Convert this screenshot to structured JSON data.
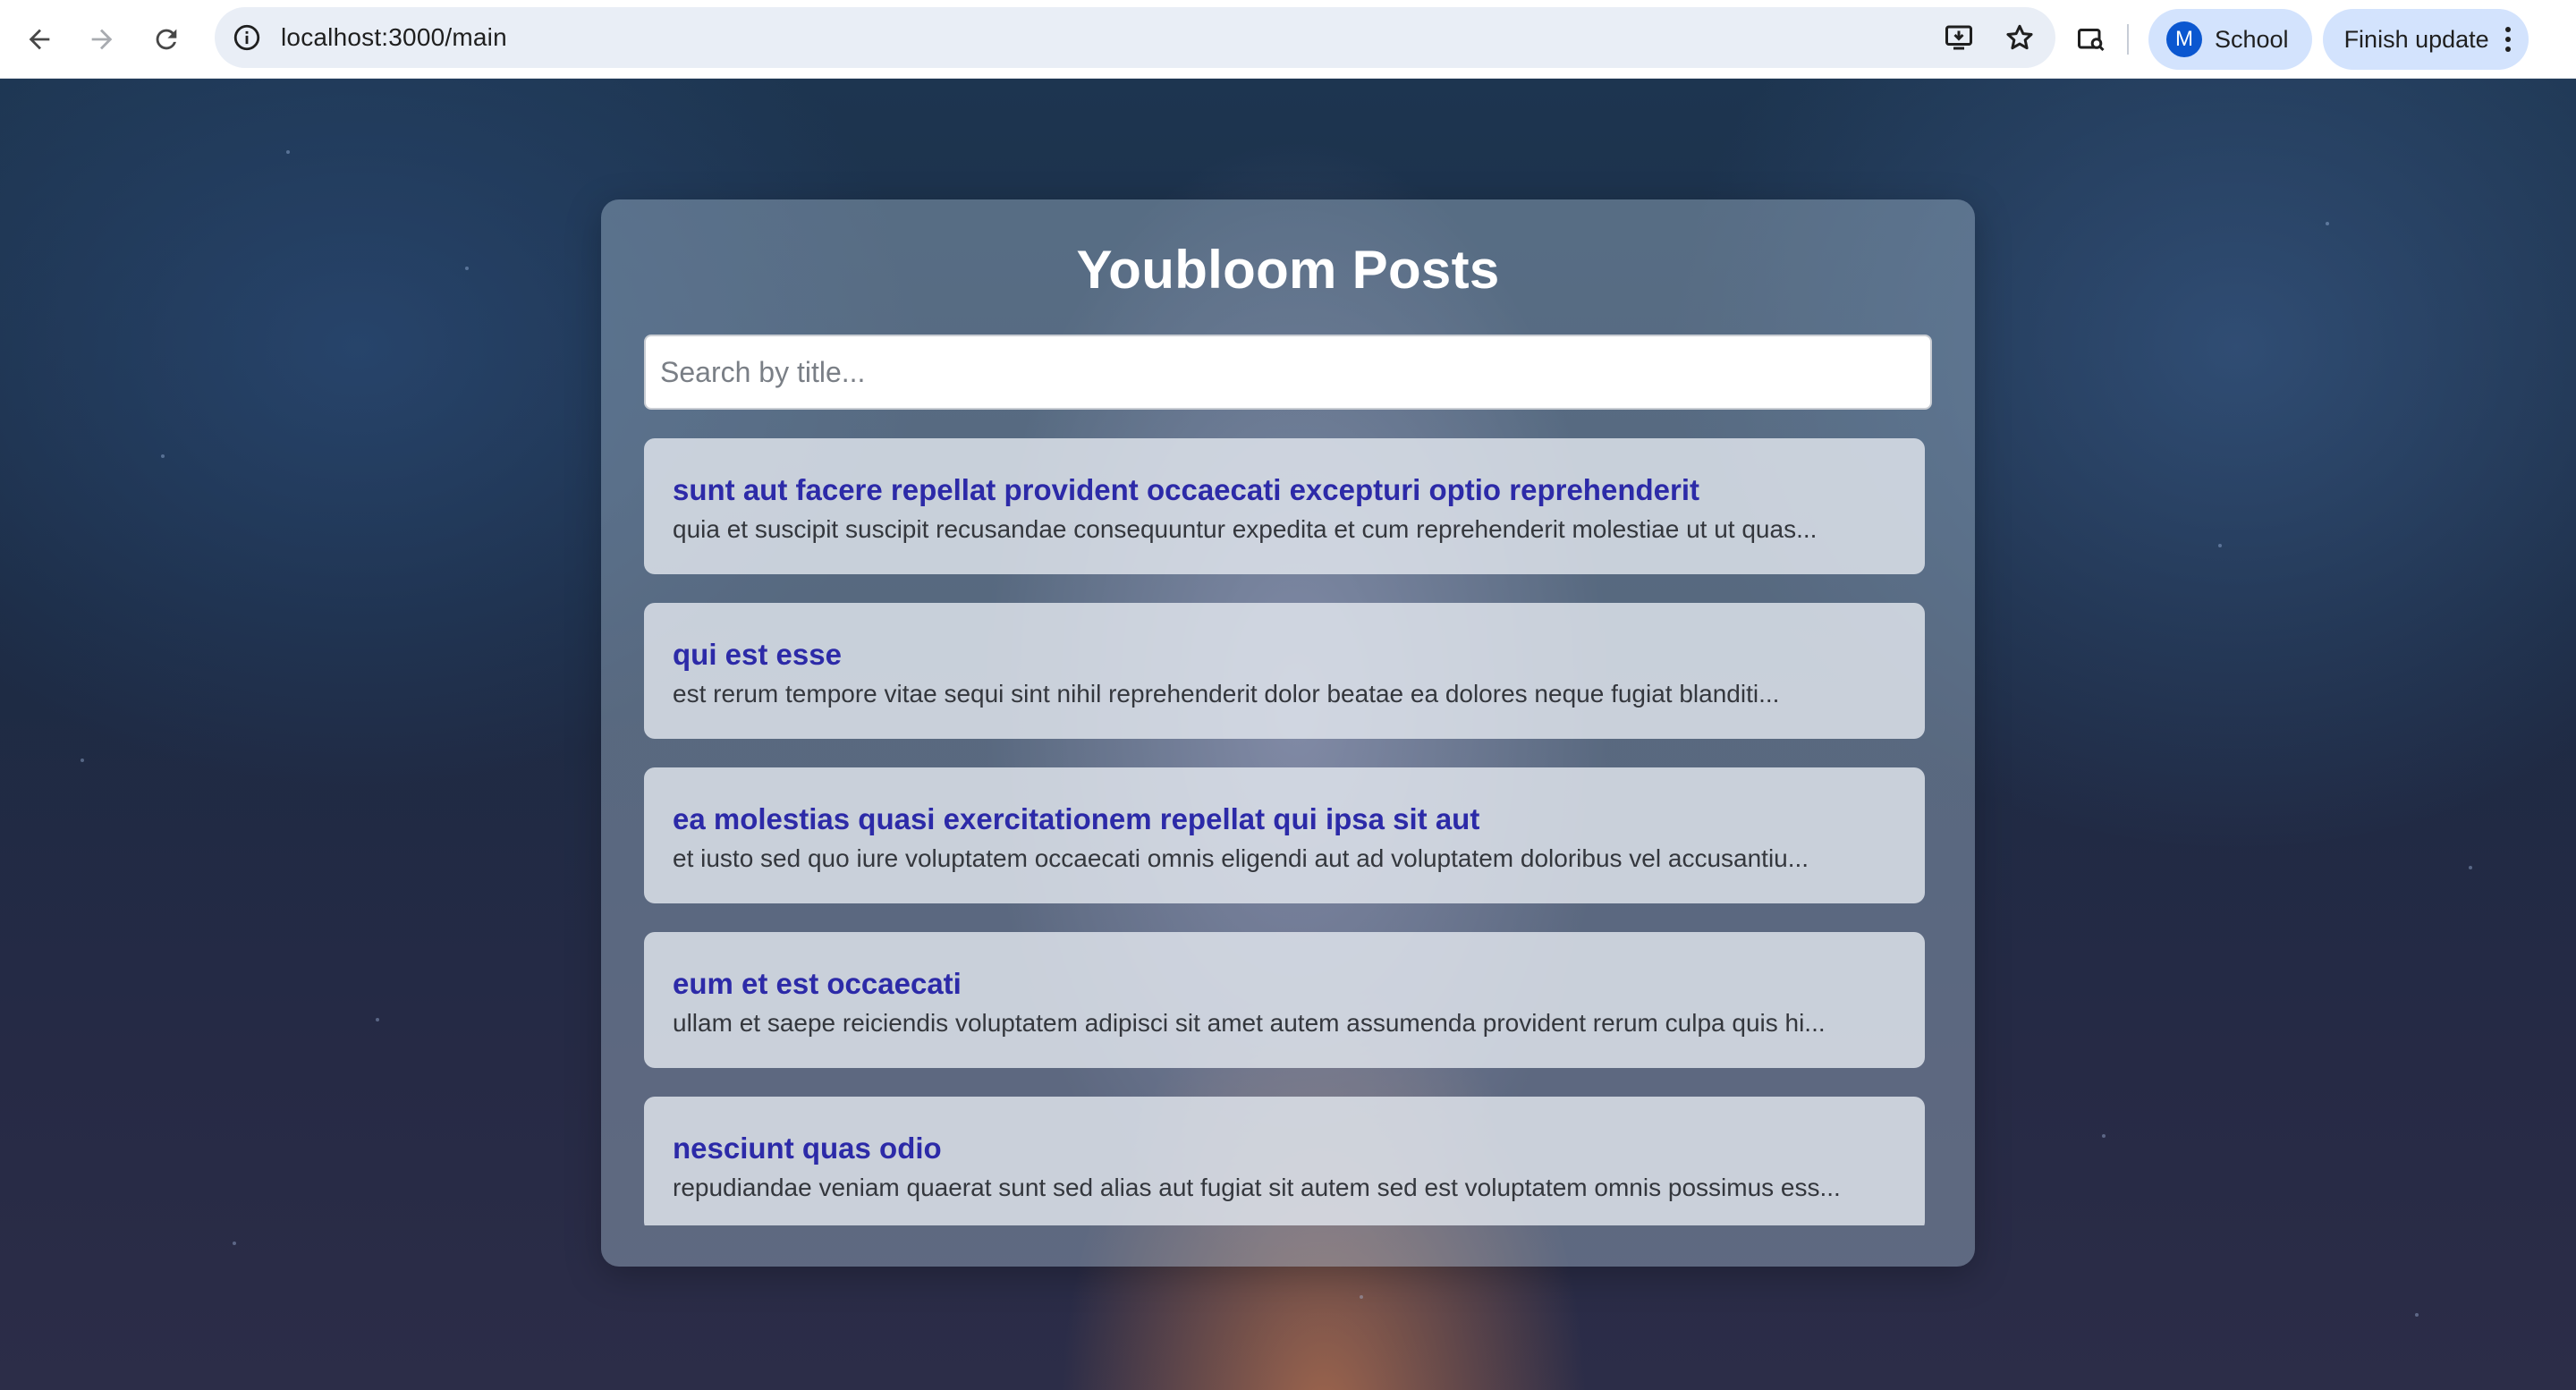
{
  "browser": {
    "url": "localhost:3000/main",
    "profile_initial": "M",
    "profile_name": "School",
    "update_label": "Finish update"
  },
  "page": {
    "title": "Youbloom Posts",
    "search_placeholder": "Search by title...",
    "search_value": "",
    "posts": [
      {
        "title": "sunt aut facere repellat provident occaecati excepturi optio reprehenderit",
        "body": "quia et suscipit suscipit recusandae consequuntur expedita et cum reprehenderit molestiae ut ut quas..."
      },
      {
        "title": "qui est esse",
        "body": "est rerum tempore vitae sequi sint nihil reprehenderit dolor beatae ea dolores neque fugiat blanditi..."
      },
      {
        "title": "ea molestias quasi exercitationem repellat qui ipsa sit aut",
        "body": "et iusto sed quo iure voluptatem occaecati omnis eligendi aut ad voluptatem doloribus vel accusantiu..."
      },
      {
        "title": "eum et est occaecati",
        "body": "ullam et saepe reiciendis voluptatem adipisci sit amet autem assumenda provident rerum culpa quis hi..."
      },
      {
        "title": "nesciunt quas odio",
        "body": "repudiandae veniam quaerat sunt sed alias aut fugiat sit autem sed est voluptatem omnis possimus ess..."
      }
    ]
  },
  "colors": {
    "post_title": "#2c2aa8",
    "chip_background": "#d3e3fd",
    "avatar": "#0b57d0"
  },
  "icons": {
    "back": "arrow-left-icon",
    "forward": "arrow-right-icon",
    "reload": "reload-icon",
    "site_info": "info-icon",
    "install": "install-app-icon",
    "bookmark": "star-icon",
    "search_tabs": "tab-search-icon",
    "menu": "kebab-menu-icon"
  }
}
